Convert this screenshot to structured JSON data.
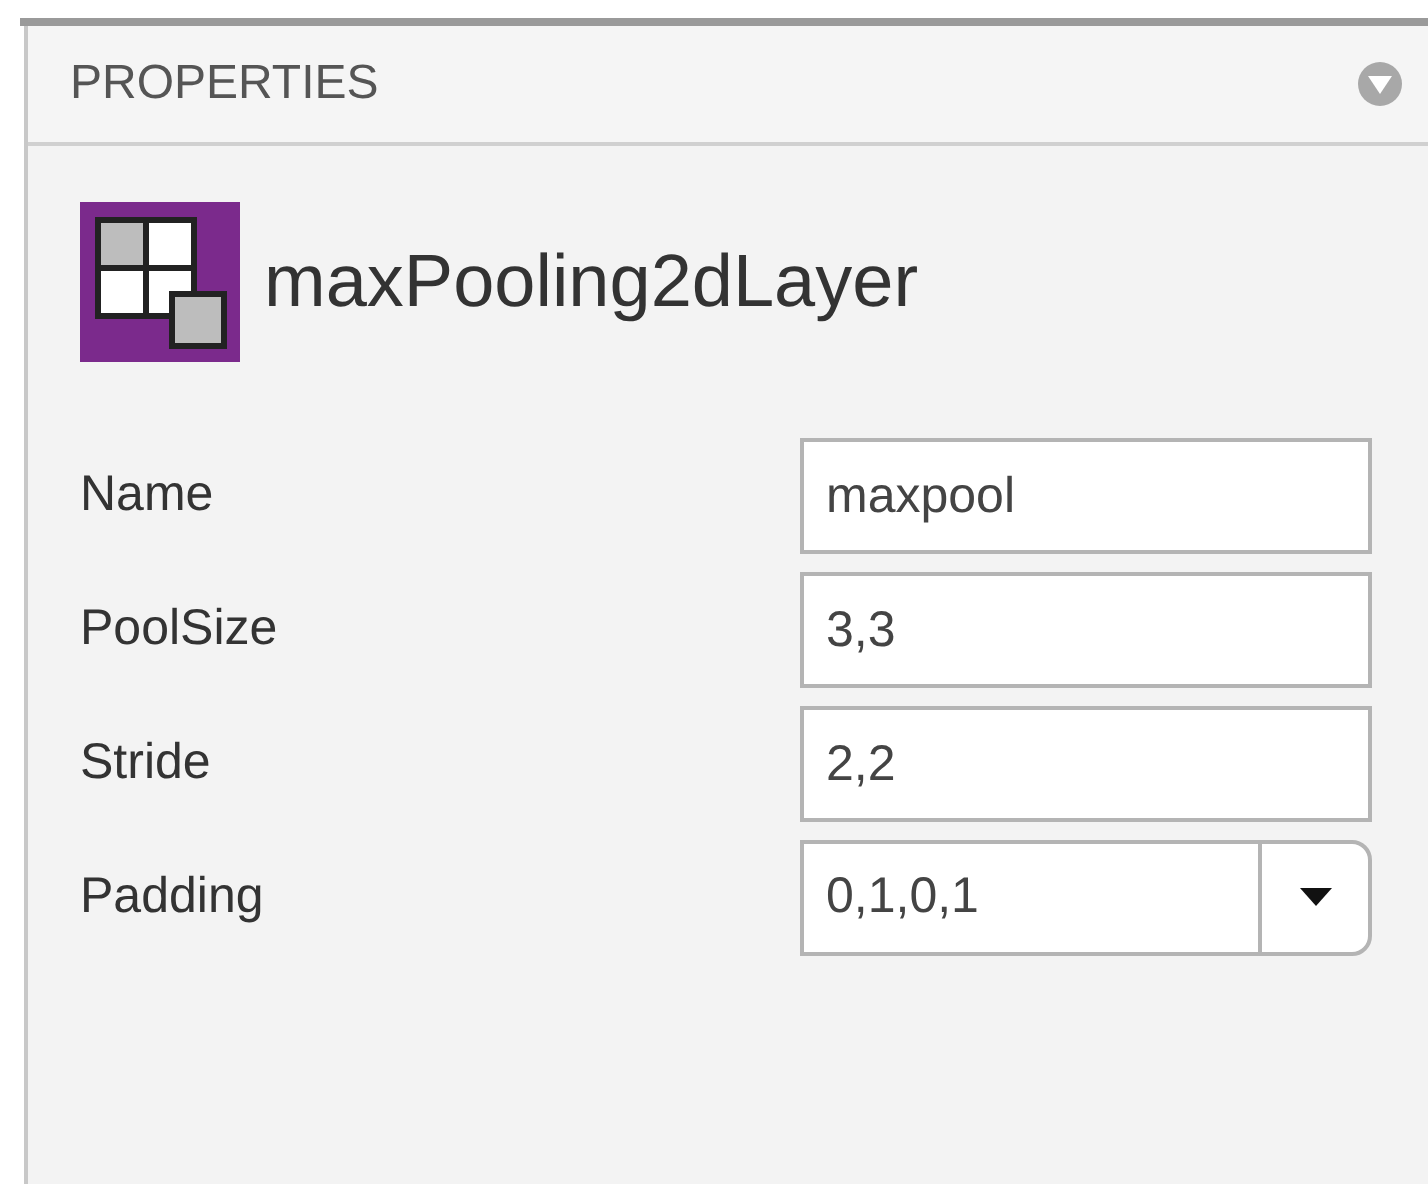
{
  "panel": {
    "title": "PROPERTIES"
  },
  "layer": {
    "name": "maxPooling2dLayer"
  },
  "properties": [
    {
      "label": "Name",
      "value": "maxpool",
      "kind": "text"
    },
    {
      "label": "PoolSize",
      "value": "3,3",
      "kind": "text"
    },
    {
      "label": "Stride",
      "value": "2,2",
      "kind": "text"
    },
    {
      "label": "Padding",
      "value": "0,1,0,1",
      "kind": "dropdown"
    }
  ]
}
